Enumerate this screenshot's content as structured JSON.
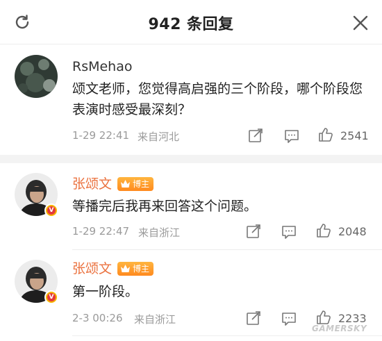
{
  "header": {
    "title": "942 条回复",
    "refresh_icon": "refresh-icon",
    "close_icon": "close-icon"
  },
  "comments": [
    {
      "author": "RsMehao",
      "text": "颂文老师，您觉得高启强的三个阶段，哪个阶段您表演时感受最深刻？",
      "time": "1-29 22:41",
      "location": "来自河北",
      "likes": "2541",
      "verified": false
    },
    {
      "author": "张颂文",
      "badge": "博主",
      "text": "等播完后我再来回答这个问题。",
      "time": "1-29 22:47",
      "location": "来自浙江",
      "likes": "2048",
      "verified": true
    },
    {
      "author": "张颂文",
      "badge": "博主",
      "text": "第一阶段。",
      "time": "2-3 00:26",
      "location": "来自浙江",
      "likes": "2233",
      "verified": true
    }
  ],
  "watermark": "GAMERSKY",
  "colors": {
    "blogger_name": "#eb7340",
    "badge": "#ff9a2a",
    "meta_text": "#9a9a9a",
    "separator": "#f3f3f3"
  },
  "icons": [
    "share-icon",
    "comment-icon",
    "like-icon",
    "verified-v-icon",
    "crown-icon"
  ]
}
